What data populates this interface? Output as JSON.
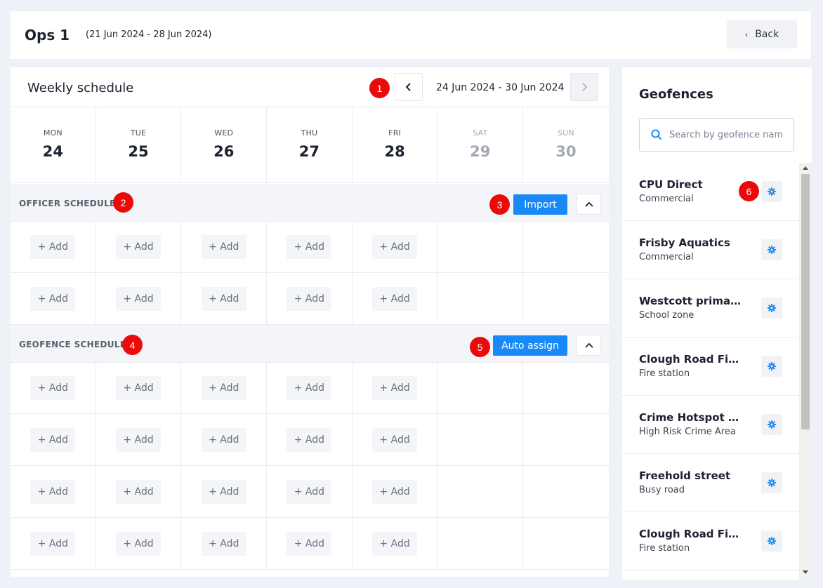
{
  "header": {
    "title": "Ops 1",
    "date_range": "(21 Jun 2024 - 28 Jun 2024)",
    "back_label": "Back",
    "back_icon": "chevron-left-icon"
  },
  "schedule": {
    "title": "Weekly schedule",
    "week_range": "24 Jun 2024 - 30 Jun 2024",
    "prev_icon": "chevron-left-icon",
    "next_icon": "chevron-right-icon",
    "days": [
      {
        "name": "MON",
        "date": "24",
        "weekend": false
      },
      {
        "name": "TUE",
        "date": "25",
        "weekend": false
      },
      {
        "name": "WED",
        "date": "26",
        "weekend": false
      },
      {
        "name": "THU",
        "date": "27",
        "weekend": false
      },
      {
        "name": "FRI",
        "date": "28",
        "weekend": false
      },
      {
        "name": "SAT",
        "date": "29",
        "weekend": true
      },
      {
        "name": "SUN",
        "date": "30",
        "weekend": true
      }
    ],
    "add_label": "+ Add",
    "officer_section": {
      "label": "OFFICER SCHEDULE",
      "action_label": "Import",
      "rows": 2
    },
    "geofence_section": {
      "label": "GEOFENCE SCHEDULE",
      "action_label": "Auto assign",
      "rows": 4
    }
  },
  "markers": [
    "1",
    "2",
    "3",
    "4",
    "5",
    "6"
  ],
  "geofences": {
    "title": "Geofences",
    "search_placeholder": "Search by geofence nam",
    "items": [
      {
        "name": "CPU Direct",
        "type": "Commercial"
      },
      {
        "name": "Frisby Aquatics",
        "type": "Commercial"
      },
      {
        "name": "Westcott primary...",
        "type": "School zone"
      },
      {
        "name": "Clough Road Fire ...",
        "type": "Fire station"
      },
      {
        "name": "Crime Hotspot Zo...",
        "type": "High Risk Crime Area"
      },
      {
        "name": "Freehold street",
        "type": "Busy road"
      },
      {
        "name": "Clough Road Fire ...",
        "type": "Fire station"
      }
    ]
  },
  "colors": {
    "primary": "#1889f5",
    "marker": "#ea0a0a",
    "background": "#eef1f7"
  }
}
